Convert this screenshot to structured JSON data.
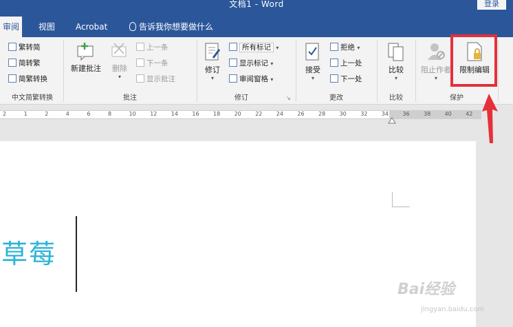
{
  "window": {
    "title": "文档1 - Word",
    "login_label": "登录"
  },
  "tabs": {
    "review": "审阅",
    "view": "视图",
    "acrobat": "Acrobat",
    "tell_me": "告诉我你想要做什么"
  },
  "ribbon": {
    "chinese": {
      "to_traditional": "繁转简",
      "to_simplified": "简转繁",
      "convert": "简繁转换",
      "label": "中文简繁转换"
    },
    "comments": {
      "new_comment": "新建批注",
      "delete": "删除",
      "previous": "上一条",
      "next": "下一条",
      "show_comments": "显示批注",
      "label": "批注"
    },
    "tracking": {
      "track_changes": "修订",
      "all_markup": "所有标记",
      "show_markup": "显示标记",
      "reviewing_pane": "审阅窗格",
      "label": "修订"
    },
    "changes": {
      "accept": "接受",
      "reject": "拒绝",
      "previous": "上一处",
      "next": "下一处",
      "label": "更改"
    },
    "compare": {
      "compare": "比较",
      "label": "比较"
    },
    "protect": {
      "block_authors": "阻止作者",
      "restrict_editing": "限制编辑",
      "label": "保护"
    }
  },
  "ruler": {
    "ticks": [
      "2",
      "1",
      "2",
      "4",
      "6",
      "8",
      "10",
      "12",
      "14",
      "16",
      "18",
      "20",
      "22",
      "24",
      "26",
      "28",
      "30",
      "32",
      "34",
      "36",
      "38",
      "40",
      "42"
    ]
  },
  "document": {
    "text": "草莓"
  },
  "watermark": {
    "brand": "Bai经验",
    "url": "jingyan.baidu.com"
  },
  "colors": {
    "title_bar": "#2b579a",
    "doc_text": "#2cb3d6",
    "highlight": "#e5303a"
  }
}
